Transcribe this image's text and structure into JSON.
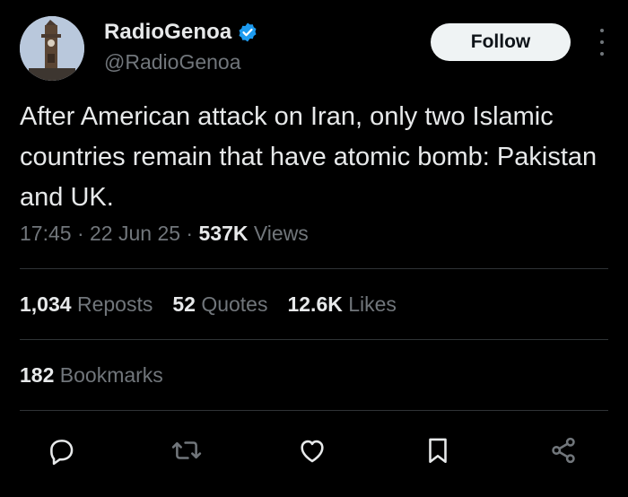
{
  "author": {
    "display_name": "RadioGenoa",
    "handle": "@RadioGenoa",
    "verified": true,
    "avatar_icon": "clock-tower-avatar"
  },
  "follow_label": "Follow",
  "tweet": {
    "text": "After American attack on Iran, only two Islamic countries remain that have atomic bomb: Pakistan and UK."
  },
  "meta": {
    "time": "17:45",
    "date": "22 Jun 25",
    "views_count": "537K",
    "views_label": "Views",
    "separator": " · "
  },
  "stats": {
    "reposts_count": "1,034",
    "reposts_label": "Reposts",
    "quotes_count": "52",
    "quotes_label": "Quotes",
    "likes_count": "12.6K",
    "likes_label": "Likes"
  },
  "bookmarks": {
    "count": "182",
    "label": "Bookmarks"
  },
  "actions": [
    "reply-icon",
    "repost-icon",
    "like-icon",
    "bookmark-icon",
    "share-icon"
  ],
  "colors": {
    "background": "#000000",
    "text_primary": "#e7e9ea",
    "text_secondary": "#71767b",
    "verified_blue": "#1d9bf0",
    "divider": "#2f3336",
    "follow_bg": "#eff3f4"
  }
}
